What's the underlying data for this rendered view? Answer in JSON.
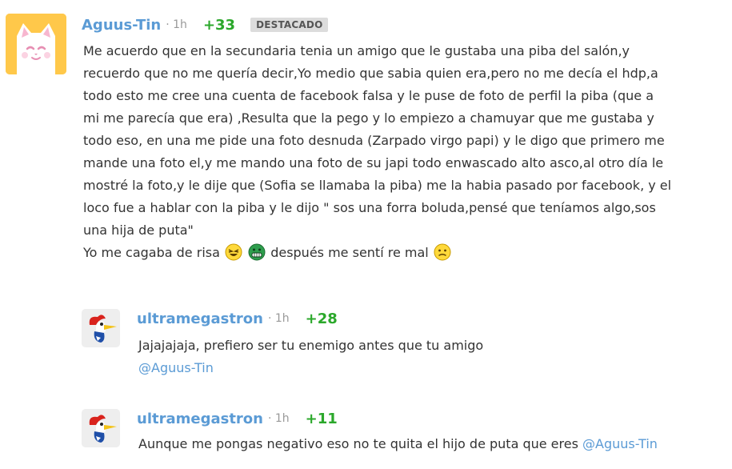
{
  "comment": {
    "username": "Aguus-Tin",
    "time": "· 1h",
    "score": "+33",
    "badge": "DESTACADO",
    "lines": [
      "Me acuerdo que en la secundaria tenia un amigo que le gustaba una piba del salón,y",
      "recuerdo que no me quería decir,Yo medio que sabia quien era,pero no me decía el hdp,a",
      "todo esto me cree una cuenta de facebook falsa y le puse de foto de perfil la piba (que a",
      "mi me parecía que era) ,Resulta que la pego y lo empiezo a chamuyar que me gustaba y",
      "todo eso, en una me pide una foto desnuda (Zarpado virgo papi) y le digo que primero me",
      "mande una foto el,y me mando una foto de su japi todo enwascado alto asco,al otro día le",
      "mostré la foto,y le dije que (Sofia se llamaba la piba) me la habia pasado por facebook, y el",
      "loco fue a hablar con la piba y le dijo \" sos una forra boluda,pensé que teníamos algo,sos",
      "una hija de puta\""
    ],
    "last_line_a": "Yo me cagaba de risa",
    "last_line_b": "después me sentí re mal",
    "emojis": [
      "laughing-emoji",
      "grinning-emoji",
      "worried-emoji"
    ]
  },
  "replies": [
    {
      "username": "ultramegastron",
      "time": "· 1h",
      "score": "+28",
      "text": "Jajajajaja, prefiero ser tu enemigo antes que tu amigo",
      "mention": "@Aguus-Tin"
    },
    {
      "username": "ultramegastron",
      "time": "· 1h",
      "score": "+11",
      "text": "Aunque me pongas negativo eso no te quita el hijo de puta que eres ",
      "mention": "@Aguus-Tin"
    }
  ],
  "colors": {
    "username": "#5b9bd5",
    "score": "#2ba82b",
    "time": "#999999",
    "badge_bg": "#dcdcdc",
    "avatar_cat_bg": "#ffc84a"
  }
}
